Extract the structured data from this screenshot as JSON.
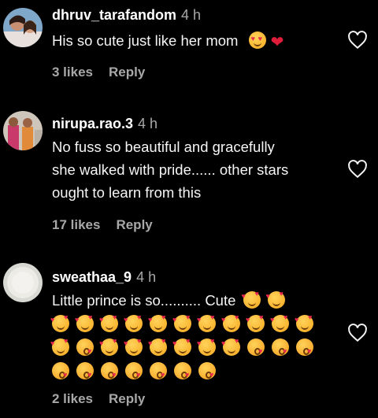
{
  "comments": [
    {
      "username": "dhruv_tarafandom",
      "time": "4 h",
      "text": "His so cute just like her mom",
      "likes": "3 likes",
      "reply": "Reply",
      "emojis": [
        "smiling-face-with-heart-eyes",
        "red-heart"
      ]
    },
    {
      "username": "nirupa.rao.3",
      "time": "4 h",
      "text_lines": [
        "No fuss so beautiful and gracefully",
        "she walked with pride...... other stars",
        "ought to learn from this"
      ],
      "likes": "17 likes",
      "reply": "Reply"
    },
    {
      "username": "sweathaa_9",
      "time": "4 h",
      "text": "Little prince is so.......... Cute",
      "likes": "2 likes",
      "reply": "Reply",
      "emoji_rows": [
        [
          "smiling-face-with-hearts",
          "smiling-face-with-hearts"
        ],
        [
          "smiling-face-with-hearts",
          "smiling-face-with-hearts",
          "smiling-face-with-hearts",
          "smiling-face-with-hearts",
          "smiling-face-with-hearts",
          "smiling-face-with-hearts",
          "smiling-face-with-hearts",
          "smiling-face-with-hearts",
          "smiling-face-with-hearts",
          "smiling-face-with-hearts",
          "smiling-face-with-hearts"
        ],
        [
          "smiling-face-with-hearts",
          "face-blowing-kiss",
          "smiling-face-with-hearts",
          "smiling-face-with-hearts",
          "smiling-face-with-hearts",
          "smiling-face-with-hearts",
          "smiling-face-with-hearts",
          "smiling-face-with-hearts",
          "face-blowing-kiss",
          "face-blowing-kiss",
          "face-blowing-kiss"
        ],
        [
          "face-blowing-kiss",
          "face-blowing-kiss",
          "face-blowing-kiss",
          "face-blowing-kiss",
          "face-blowing-kiss",
          "face-blowing-kiss",
          "face-blowing-kiss"
        ]
      ]
    }
  ],
  "colors": {
    "background": "#000000",
    "text": "#f5f5f5",
    "muted": "#a8a8a8"
  }
}
